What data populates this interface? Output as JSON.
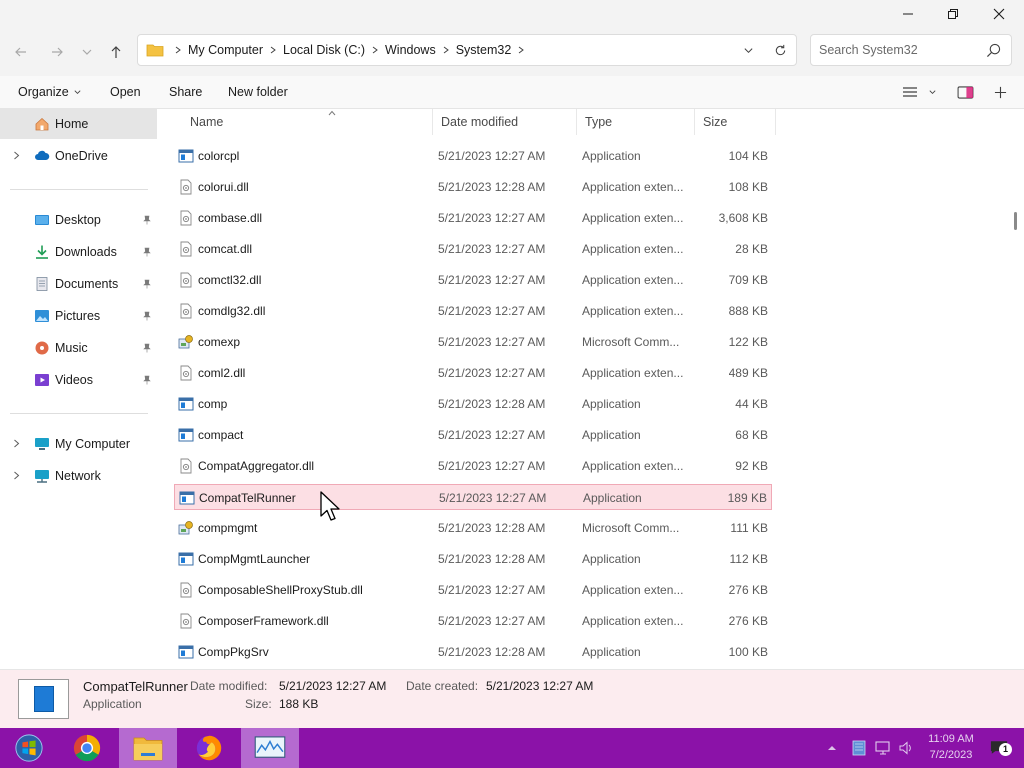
{
  "window": {
    "minimize_label": "Minimize",
    "maximize_label": "Maximize",
    "close_label": "Close"
  },
  "address": {
    "breadcrumbs": [
      "My Computer",
      "Local Disk (C:)",
      "Windows",
      "System32"
    ],
    "search_placeholder": "Search System32"
  },
  "commands": {
    "organize": "Organize",
    "open": "Open",
    "share": "Share",
    "new_folder": "New folder"
  },
  "sidebar": {
    "items": [
      {
        "label": "Home",
        "icon": "home-icon"
      },
      {
        "label": "OneDrive",
        "icon": "cloud-icon"
      },
      {
        "label": "Desktop",
        "icon": "desktop-icon"
      },
      {
        "label": "Downloads",
        "icon": "download-icon"
      },
      {
        "label": "Documents",
        "icon": "document-icon"
      },
      {
        "label": "Pictures",
        "icon": "picture-icon"
      },
      {
        "label": "Music",
        "icon": "music-icon"
      },
      {
        "label": "Videos",
        "icon": "video-icon"
      },
      {
        "label": "My Computer",
        "icon": "computer-icon"
      },
      {
        "label": "Network",
        "icon": "network-icon"
      }
    ]
  },
  "columns": {
    "name": "Name",
    "date": "Date modified",
    "type": "Type",
    "size": "Size"
  },
  "files": [
    {
      "name": "colorcpl",
      "date": "5/21/2023 12:27 AM",
      "type": "Application",
      "size": "104 KB",
      "icon": "app-icon"
    },
    {
      "name": "colorui.dll",
      "date": "5/21/2023 12:28 AM",
      "type": "Application exten...",
      "size": "108 KB",
      "icon": "dll-icon"
    },
    {
      "name": "combase.dll",
      "date": "5/21/2023 12:27 AM",
      "type": "Application exten...",
      "size": "3,608 KB",
      "icon": "dll-icon"
    },
    {
      "name": "comcat.dll",
      "date": "5/21/2023 12:27 AM",
      "type": "Application exten...",
      "size": "28 KB",
      "icon": "dll-icon"
    },
    {
      "name": "comctl32.dll",
      "date": "5/21/2023 12:27 AM",
      "type": "Application exten...",
      "size": "709 KB",
      "icon": "dll-icon"
    },
    {
      "name": "comdlg32.dll",
      "date": "5/21/2023 12:27 AM",
      "type": "Application exten...",
      "size": "888 KB",
      "icon": "dll-icon"
    },
    {
      "name": "comexp",
      "date": "5/21/2023 12:27 AM",
      "type": "Microsoft Comm...",
      "size": "122 KB",
      "icon": "msc-icon"
    },
    {
      "name": "coml2.dll",
      "date": "5/21/2023 12:27 AM",
      "type": "Application exten...",
      "size": "489 KB",
      "icon": "dll-icon"
    },
    {
      "name": "comp",
      "date": "5/21/2023 12:28 AM",
      "type": "Application",
      "size": "44 KB",
      "icon": "app-icon"
    },
    {
      "name": "compact",
      "date": "5/21/2023 12:27 AM",
      "type": "Application",
      "size": "68 KB",
      "icon": "app-icon"
    },
    {
      "name": "CompatAggregator.dll",
      "date": "5/21/2023 12:27 AM",
      "type": "Application exten...",
      "size": "92 KB",
      "icon": "dll-icon"
    },
    {
      "name": "CompatTelRunner",
      "date": "5/21/2023 12:27 AM",
      "type": "Application",
      "size": "189 KB",
      "icon": "app-icon"
    },
    {
      "name": "compmgmt",
      "date": "5/21/2023 12:28 AM",
      "type": "Microsoft Comm...",
      "size": "111 KB",
      "icon": "msc-icon"
    },
    {
      "name": "CompMgmtLauncher",
      "date": "5/21/2023 12:28 AM",
      "type": "Application",
      "size": "112 KB",
      "icon": "app-icon"
    },
    {
      "name": "ComposableShellProxyStub.dll",
      "date": "5/21/2023 12:27 AM",
      "type": "Application exten...",
      "size": "276 KB",
      "icon": "dll-icon"
    },
    {
      "name": "ComposerFramework.dll",
      "date": "5/21/2023 12:27 AM",
      "type": "Application exten...",
      "size": "276 KB",
      "icon": "dll-icon"
    },
    {
      "name": "CompPkgSrv",
      "date": "5/21/2023 12:28 AM",
      "type": "Application",
      "size": "100 KB",
      "icon": "app-icon"
    }
  ],
  "details": {
    "name": "CompatTelRunner",
    "type": "Application",
    "date_modified_label": "Date modified:",
    "date_modified": "5/21/2023 12:27 AM",
    "date_created_label": "Date created:",
    "date_created": "5/21/2023 12:27 AM",
    "size_label": "Size:",
    "size": "188 KB"
  },
  "taskbar": {
    "time": "11:09 AM",
    "date": "7/2/2023",
    "notification_count": "1"
  },
  "colors": {
    "taskbar": "#8b12a8",
    "selection": "#fcdfe4",
    "details_pane": "#fcecef"
  }
}
